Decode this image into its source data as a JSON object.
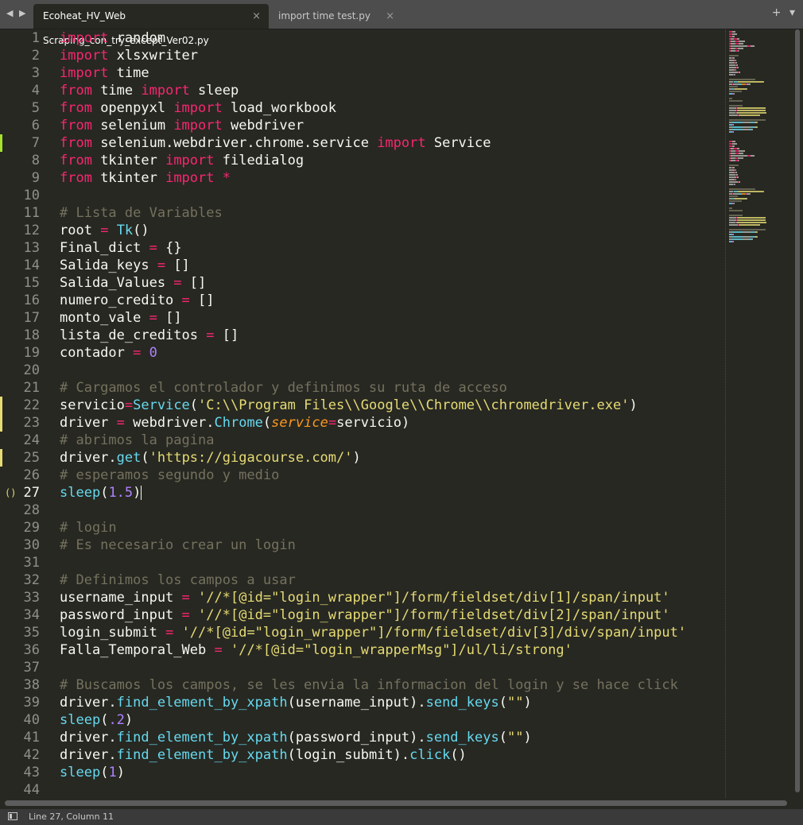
{
  "tabs": [
    {
      "label": "Ecoheat_HV_Web Scraping_con_try_except_Ver02.py",
      "active": true
    },
    {
      "label": "import time test.py",
      "active": false
    }
  ],
  "tab_close_glyph": "×",
  "tabbar_controls": {
    "add": "+",
    "menu": "▾"
  },
  "status": {
    "position": "Line 27, Column 11"
  },
  "gutter": {
    "current_line": 27,
    "brace_marker": "()"
  },
  "line_numbers": [
    "1",
    "2",
    "3",
    "4",
    "5",
    "6",
    "7",
    "8",
    "9",
    "10",
    "11",
    "12",
    "13",
    "14",
    "15",
    "16",
    "17",
    "18",
    "19",
    "20",
    "21",
    "22",
    "23",
    "24",
    "25",
    "26",
    "27",
    "28",
    "29",
    "30",
    "31",
    "32",
    "33",
    "34",
    "35",
    "36",
    "37",
    "38",
    "39",
    "40",
    "41",
    "42",
    "43",
    "44"
  ],
  "modified_lines": {
    "added": [
      7
    ],
    "modified": [
      22,
      23,
      25
    ]
  },
  "theme_colors": {
    "background": "#272822",
    "keyword": "#f92672",
    "function": "#66d9ef",
    "string": "#e6db74",
    "number": "#ae81ff",
    "comment": "#75715e",
    "parameter": "#fd971f",
    "text": "#f8f8f2"
  },
  "code_lines": [
    [
      [
        "kw",
        "import"
      ],
      [
        "t",
        " random"
      ]
    ],
    [
      [
        "kw",
        "import"
      ],
      [
        "t",
        " xlsxwriter"
      ]
    ],
    [
      [
        "kw",
        "import"
      ],
      [
        "t",
        " time"
      ]
    ],
    [
      [
        "kw",
        "from"
      ],
      [
        "t",
        " time "
      ],
      [
        "kw",
        "import"
      ],
      [
        "t",
        " sleep"
      ]
    ],
    [
      [
        "kw",
        "from"
      ],
      [
        "t",
        " openpyxl "
      ],
      [
        "kw",
        "import"
      ],
      [
        "t",
        " load_workbook"
      ]
    ],
    [
      [
        "kw",
        "from"
      ],
      [
        "t",
        " selenium "
      ],
      [
        "kw",
        "import"
      ],
      [
        "t",
        " webdriver"
      ]
    ],
    [
      [
        "kw",
        "from"
      ],
      [
        "t",
        " selenium.webdriver.chrome.service "
      ],
      [
        "kw",
        "import"
      ],
      [
        "t",
        " Service"
      ]
    ],
    [
      [
        "kw",
        "from"
      ],
      [
        "t",
        " tkinter "
      ],
      [
        "kw",
        "import"
      ],
      [
        "t",
        " filedialog"
      ]
    ],
    [
      [
        "kw",
        "from"
      ],
      [
        "t",
        " tkinter "
      ],
      [
        "kw",
        "import"
      ],
      [
        "t",
        " "
      ],
      [
        "op",
        "*"
      ]
    ],
    [],
    [
      [
        "cm",
        "# Lista de Variables"
      ]
    ],
    [
      [
        "t",
        "root "
      ],
      [
        "op",
        "="
      ],
      [
        "t",
        " "
      ],
      [
        "fn",
        "Tk"
      ],
      [
        "t",
        "()"
      ]
    ],
    [
      [
        "t",
        "Final_dict "
      ],
      [
        "op",
        "="
      ],
      [
        "t",
        " {}"
      ]
    ],
    [
      [
        "t",
        "Salida_keys "
      ],
      [
        "op",
        "="
      ],
      [
        "t",
        " []"
      ]
    ],
    [
      [
        "t",
        "Salida_Values "
      ],
      [
        "op",
        "="
      ],
      [
        "t",
        " []"
      ]
    ],
    [
      [
        "t",
        "numero_credito "
      ],
      [
        "op",
        "="
      ],
      [
        "t",
        " []"
      ]
    ],
    [
      [
        "t",
        "monto_vale "
      ],
      [
        "op",
        "="
      ],
      [
        "t",
        " []"
      ]
    ],
    [
      [
        "t",
        "lista_de_creditos "
      ],
      [
        "op",
        "="
      ],
      [
        "t",
        " []"
      ]
    ],
    [
      [
        "t",
        "contador "
      ],
      [
        "op",
        "="
      ],
      [
        "t",
        " "
      ],
      [
        "num",
        "0"
      ]
    ],
    [],
    [
      [
        "cm",
        "# Cargamos el controlador y definimos su ruta de acceso"
      ]
    ],
    [
      [
        "t",
        "servicio"
      ],
      [
        "op",
        "="
      ],
      [
        "fn",
        "Service"
      ],
      [
        "t",
        "("
      ],
      [
        "str",
        "'C:\\\\Program Files\\\\Google\\\\Chrome\\\\chromedriver.exe'"
      ],
      [
        "t",
        ")"
      ]
    ],
    [
      [
        "t",
        "driver "
      ],
      [
        "op",
        "="
      ],
      [
        "t",
        " webdriver."
      ],
      [
        "fn",
        "Chrome"
      ],
      [
        "t",
        "("
      ],
      [
        "par",
        "service"
      ],
      [
        "op",
        "="
      ],
      [
        "t",
        "servicio)"
      ]
    ],
    [
      [
        "cm",
        "# abrimos la pagina"
      ]
    ],
    [
      [
        "t",
        "driver."
      ],
      [
        "fn",
        "get"
      ],
      [
        "t",
        "("
      ],
      [
        "str",
        "'https://gigacourse.com/'"
      ],
      [
        "t",
        ")"
      ]
    ],
    [
      [
        "cm",
        "# esperamos segundo y medio"
      ]
    ],
    [
      [
        "fn",
        "sleep"
      ],
      [
        "t",
        "("
      ],
      [
        "num",
        "1.5"
      ],
      [
        "t",
        ")"
      ],
      [
        "caret",
        ""
      ]
    ],
    [],
    [
      [
        "cm",
        "# login"
      ]
    ],
    [
      [
        "cm",
        "# Es necesario crear un login"
      ]
    ],
    [],
    [
      [
        "cm",
        "# Definimos los campos a usar"
      ]
    ],
    [
      [
        "t",
        "username_input "
      ],
      [
        "op",
        "="
      ],
      [
        "t",
        " "
      ],
      [
        "str",
        "'//*[@id=\"login_wrapper\"]/form/fieldset/div[1]/span/input'"
      ]
    ],
    [
      [
        "t",
        "password_input "
      ],
      [
        "op",
        "="
      ],
      [
        "t",
        " "
      ],
      [
        "str",
        "'//*[@id=\"login_wrapper\"]/form/fieldset/div[2]/span/input'"
      ]
    ],
    [
      [
        "t",
        "login_submit "
      ],
      [
        "op",
        "="
      ],
      [
        "t",
        " "
      ],
      [
        "str",
        "'//*[@id=\"login_wrapper\"]/form/fieldset/div[3]/div/span/input'"
      ]
    ],
    [
      [
        "t",
        "Falla_Temporal_Web "
      ],
      [
        "op",
        "="
      ],
      [
        "t",
        " "
      ],
      [
        "str",
        "'//*[@id=\"login_wrapperMsg\"]/ul/li/strong'"
      ]
    ],
    [],
    [
      [
        "cm",
        "# Buscamos los campos, se les envia la informacion del login y se hace click"
      ]
    ],
    [
      [
        "t",
        "driver."
      ],
      [
        "fn",
        "find_element_by_xpath"
      ],
      [
        "t",
        "(username_input)."
      ],
      [
        "fn",
        "send_keys"
      ],
      [
        "t",
        "("
      ],
      [
        "str",
        "\"\""
      ],
      [
        "t",
        ")"
      ]
    ],
    [
      [
        "fn",
        "sleep"
      ],
      [
        "t",
        "("
      ],
      [
        "num",
        ".2"
      ],
      [
        "t",
        ")"
      ]
    ],
    [
      [
        "t",
        "driver."
      ],
      [
        "fn",
        "find_element_by_xpath"
      ],
      [
        "t",
        "(password_input)."
      ],
      [
        "fn",
        "send_keys"
      ],
      [
        "t",
        "("
      ],
      [
        "str",
        "\"\""
      ],
      [
        "t",
        ")"
      ]
    ],
    [
      [
        "t",
        "driver."
      ],
      [
        "fn",
        "find_element_by_xpath"
      ],
      [
        "t",
        "(login_submit)."
      ],
      [
        "fn",
        "click"
      ],
      [
        "t",
        "()"
      ]
    ],
    [
      [
        "fn",
        "sleep"
      ],
      [
        "t",
        "("
      ],
      [
        "num",
        "1"
      ],
      [
        "t",
        ")"
      ]
    ],
    []
  ]
}
